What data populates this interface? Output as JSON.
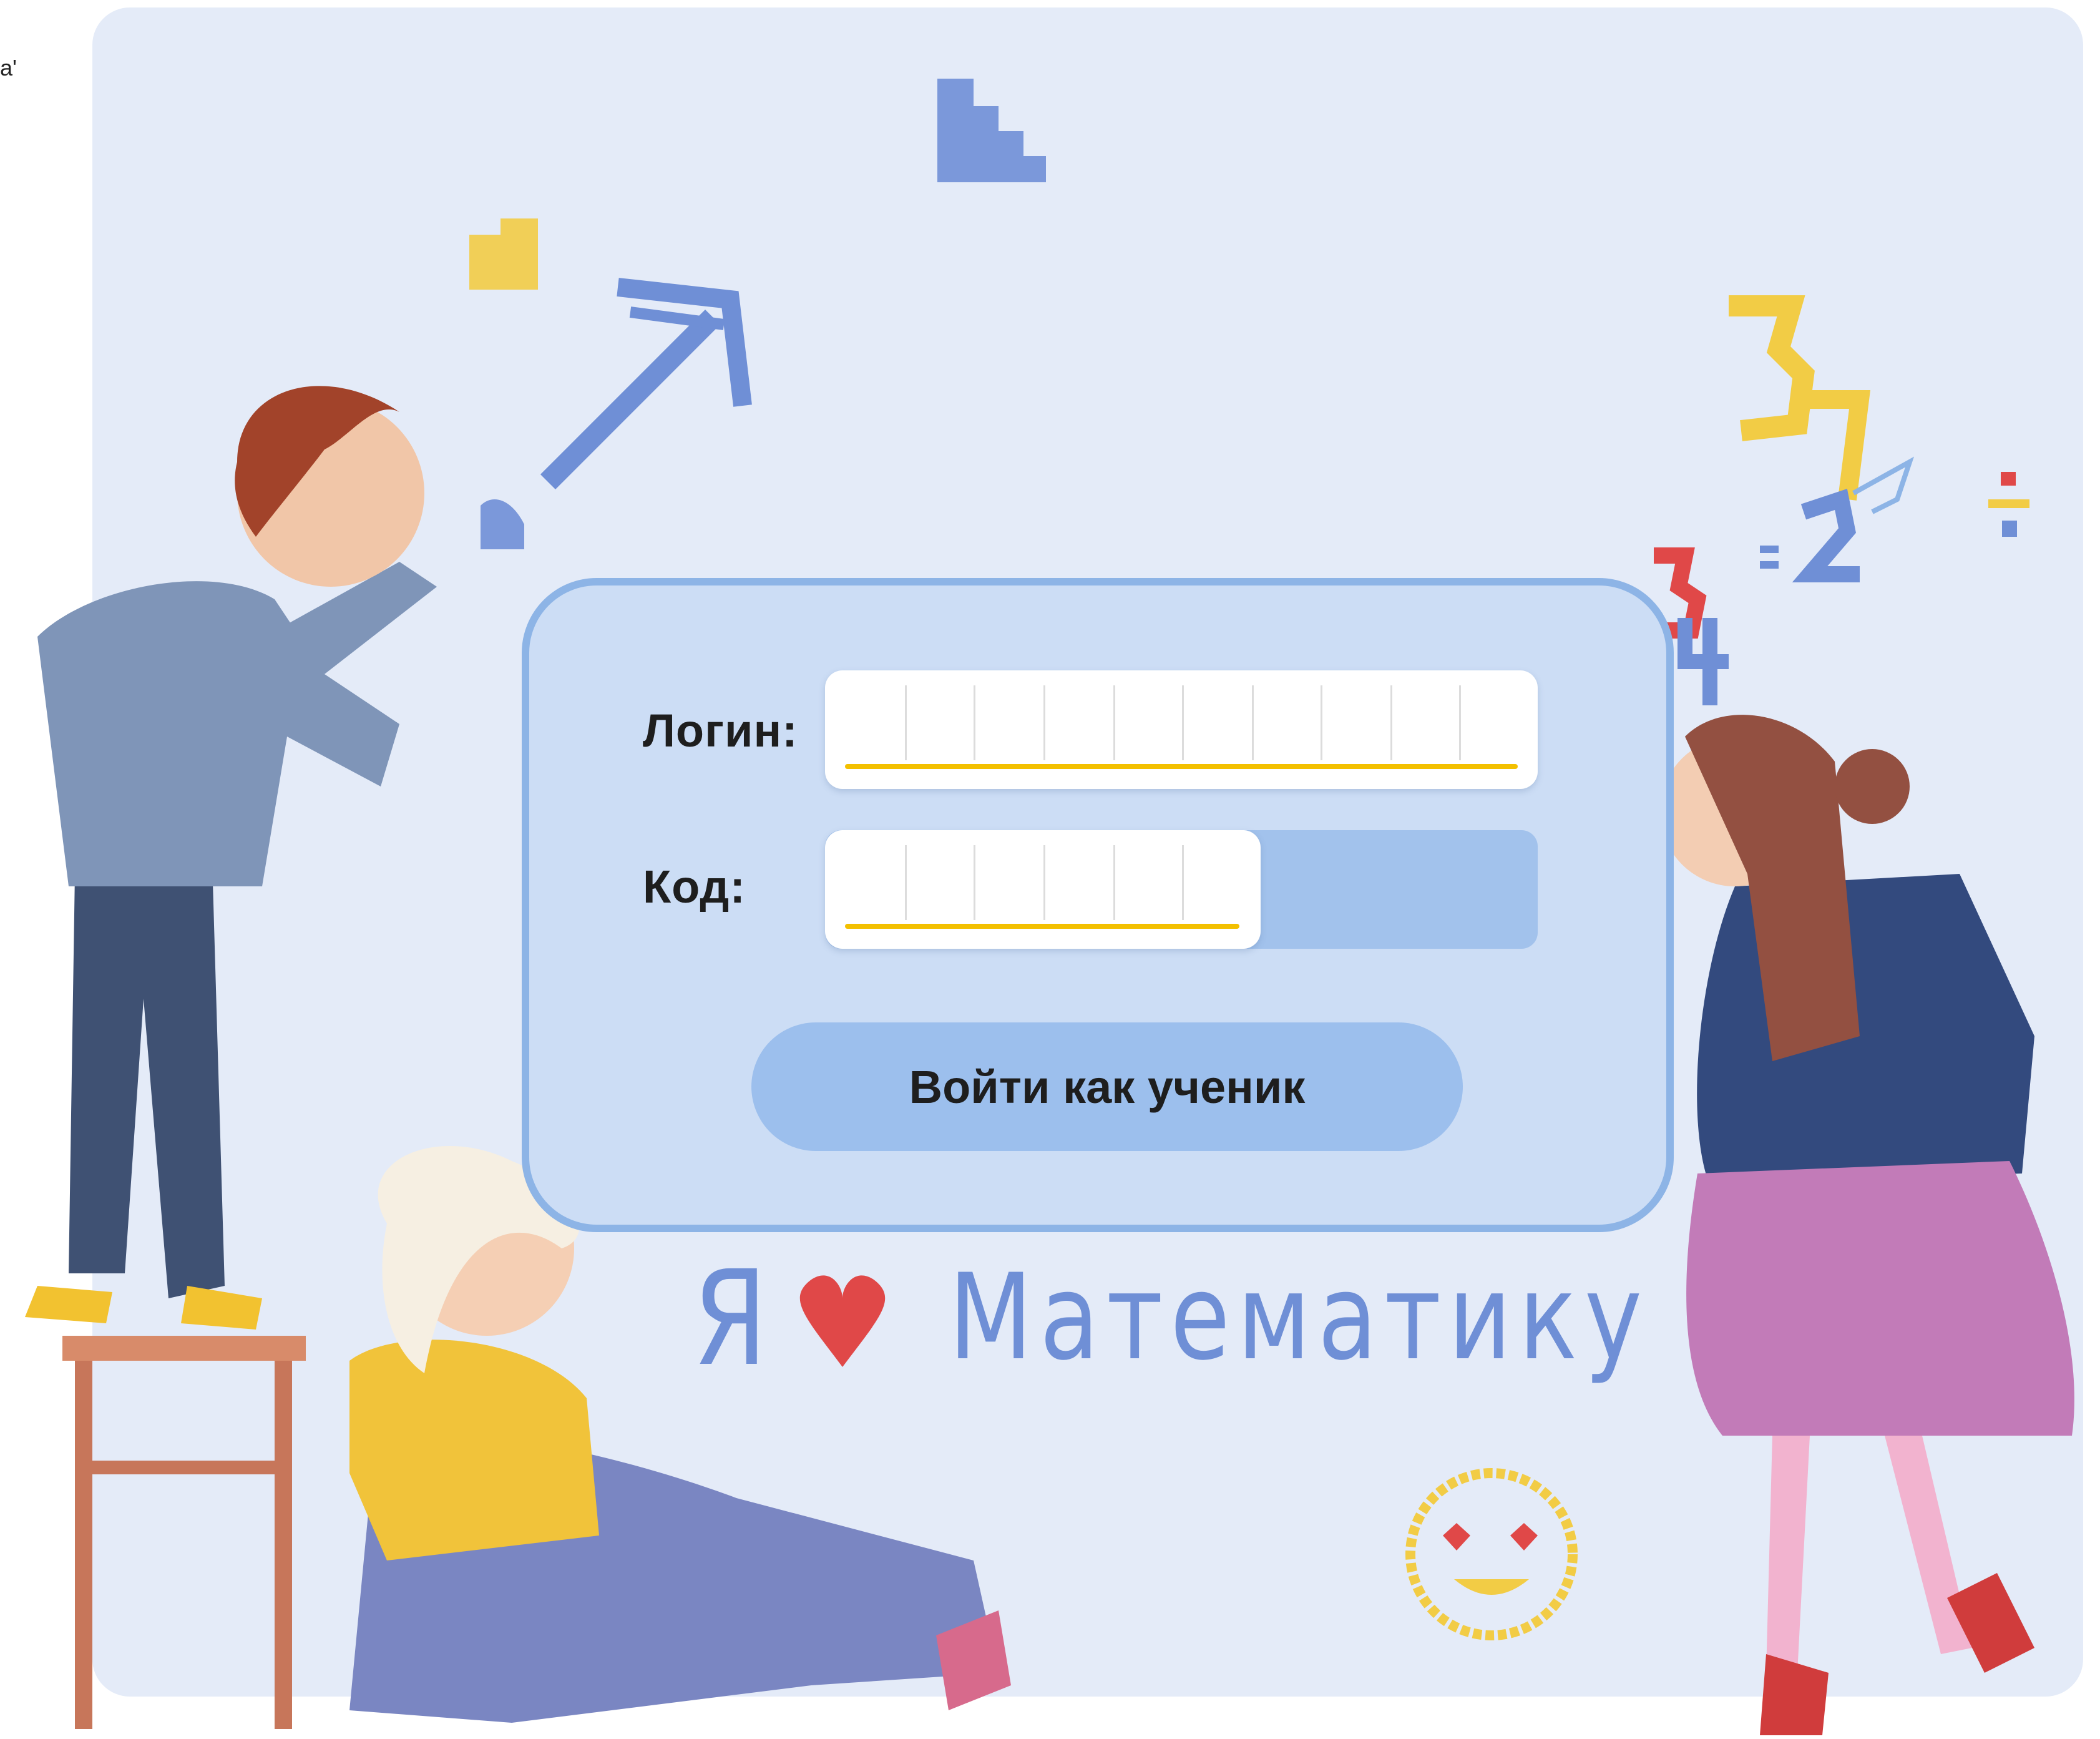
{
  "edge_fragment": "а'",
  "form": {
    "login_label": "Логин:",
    "code_label": "Код:",
    "login_input_value": "",
    "code_input_value": "",
    "submit_label": "Войти как ученик"
  },
  "decor": {
    "chalk_word_1": "Я",
    "chalk_word_2": "Математику",
    "numbers": [
      "3",
      "7",
      "5",
      "4",
      "2",
      "="
    ]
  },
  "colors": {
    "board_background": "#e4ebf8",
    "card_background": "#ccddf5",
    "card_border": "#8db4e6",
    "button_background": "#9cbfed",
    "input_underline": "#f3c000",
    "chalk_blue": "#6f8fd6",
    "chalk_red": "#e04848",
    "chalk_yellow": "#f2cc45"
  }
}
